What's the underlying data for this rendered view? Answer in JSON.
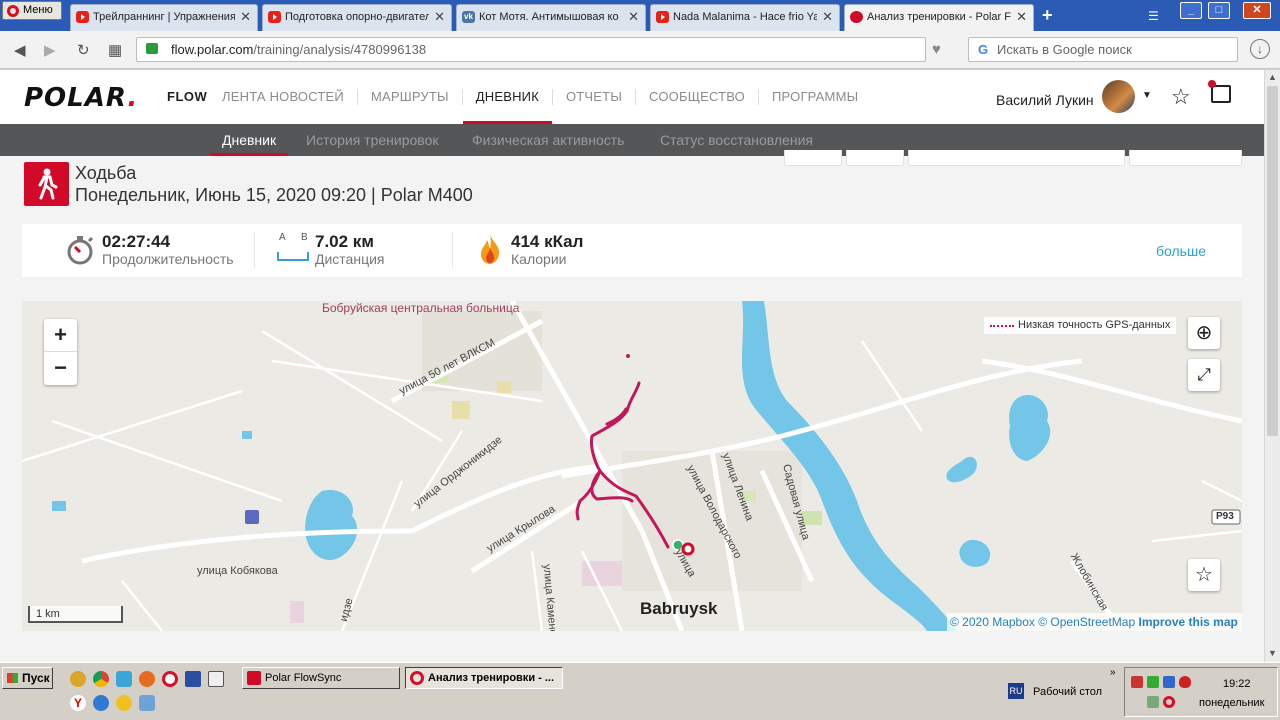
{
  "browser": {
    "menu_label": "Меню",
    "tabs": [
      {
        "title": "Трейлраннинг | Упражнения",
        "icon": "youtube-icon"
      },
      {
        "title": "Подготовка опорно-двигательного",
        "icon": "youtube-icon"
      },
      {
        "title": "Кот Мотя. Антимышовая ко",
        "icon": "vk-icon"
      },
      {
        "title": "Nada Malanima - Hace frio Ya",
        "icon": "youtube-icon"
      },
      {
        "title": "Анализ тренировки - Polar Flow",
        "icon": "polar-icon"
      }
    ],
    "url_host": "flow.polar.com",
    "url_path": "/training/analysis/4780996138",
    "search_placeholder": "Искать в Google поиск"
  },
  "header": {
    "logo": "POLAR",
    "flow": "FLOW",
    "nav": [
      {
        "label": "ЛЕНТА НОВОСТЕЙ",
        "active": false
      },
      {
        "label": "МАРШРУТЫ",
        "active": false
      },
      {
        "label": "ДНЕВНИК",
        "active": true
      },
      {
        "label": "ОТЧЕТЫ",
        "active": false
      },
      {
        "label": "СООБЩЕСТВО",
        "active": false
      },
      {
        "label": "ПРОГРАММЫ",
        "active": false
      }
    ],
    "user_name": "Василий Лукин"
  },
  "subnav": [
    {
      "label": "Дневник",
      "active": true
    },
    {
      "label": "История тренировок",
      "active": false
    },
    {
      "label": "Физическая активность",
      "active": false
    },
    {
      "label": "Статус восстановления",
      "active": false
    }
  ],
  "activity": {
    "sport": "Ходьба",
    "subtitle": "Понедельник, Июнь 15, 2020 09:20 | Polar M400"
  },
  "summary": {
    "duration_value": "02:27:44",
    "duration_label": "Продолжительность",
    "distance_value": "7.02 км",
    "distance_label": "Дистанция",
    "distance_a": "A",
    "distance_b": "B",
    "calories_value": "414 кКал",
    "calories_label": "Калории",
    "more_label": "больше"
  },
  "map": {
    "gps_legend": "Низкая точность GPS-данных",
    "scale": "1 km",
    "attrib_mapbox": "© 2020 Mapbox",
    "attrib_osm": "© OpenStreetMap",
    "attrib_improve": "Improve this map",
    "city": "Babruysk",
    "poi": "Бобруйская центральная больница",
    "road_shield": "P93",
    "streets": {
      "vlksm": "улица 50 лет ВЛКСМ",
      "ordzhonikidze": "улица Орджоникидзе",
      "krylova": "улица Крылова",
      "kobyakova": "улица Кобякова",
      "volodarskogo": "улица Володарского",
      "lenina": "улица Ленина",
      "sadovaya": "Садовая улица",
      "kamenskaya": "улица Каменск",
      "zhlobinskaya": "Жлобинская",
      "ulitsa": "улица",
      "ze": "идзе"
    },
    "route_color": "#c2185b"
  },
  "taskbar": {
    "start": "Пуск",
    "buttons": [
      {
        "label": "Polar FlowSync",
        "pressed": false
      },
      {
        "label": "Анализ тренировки - ...",
        "pressed": true
      }
    ],
    "lang": "RU",
    "desktop": "Рабочий стол",
    "time": "19:22",
    "day": "понедельник"
  }
}
